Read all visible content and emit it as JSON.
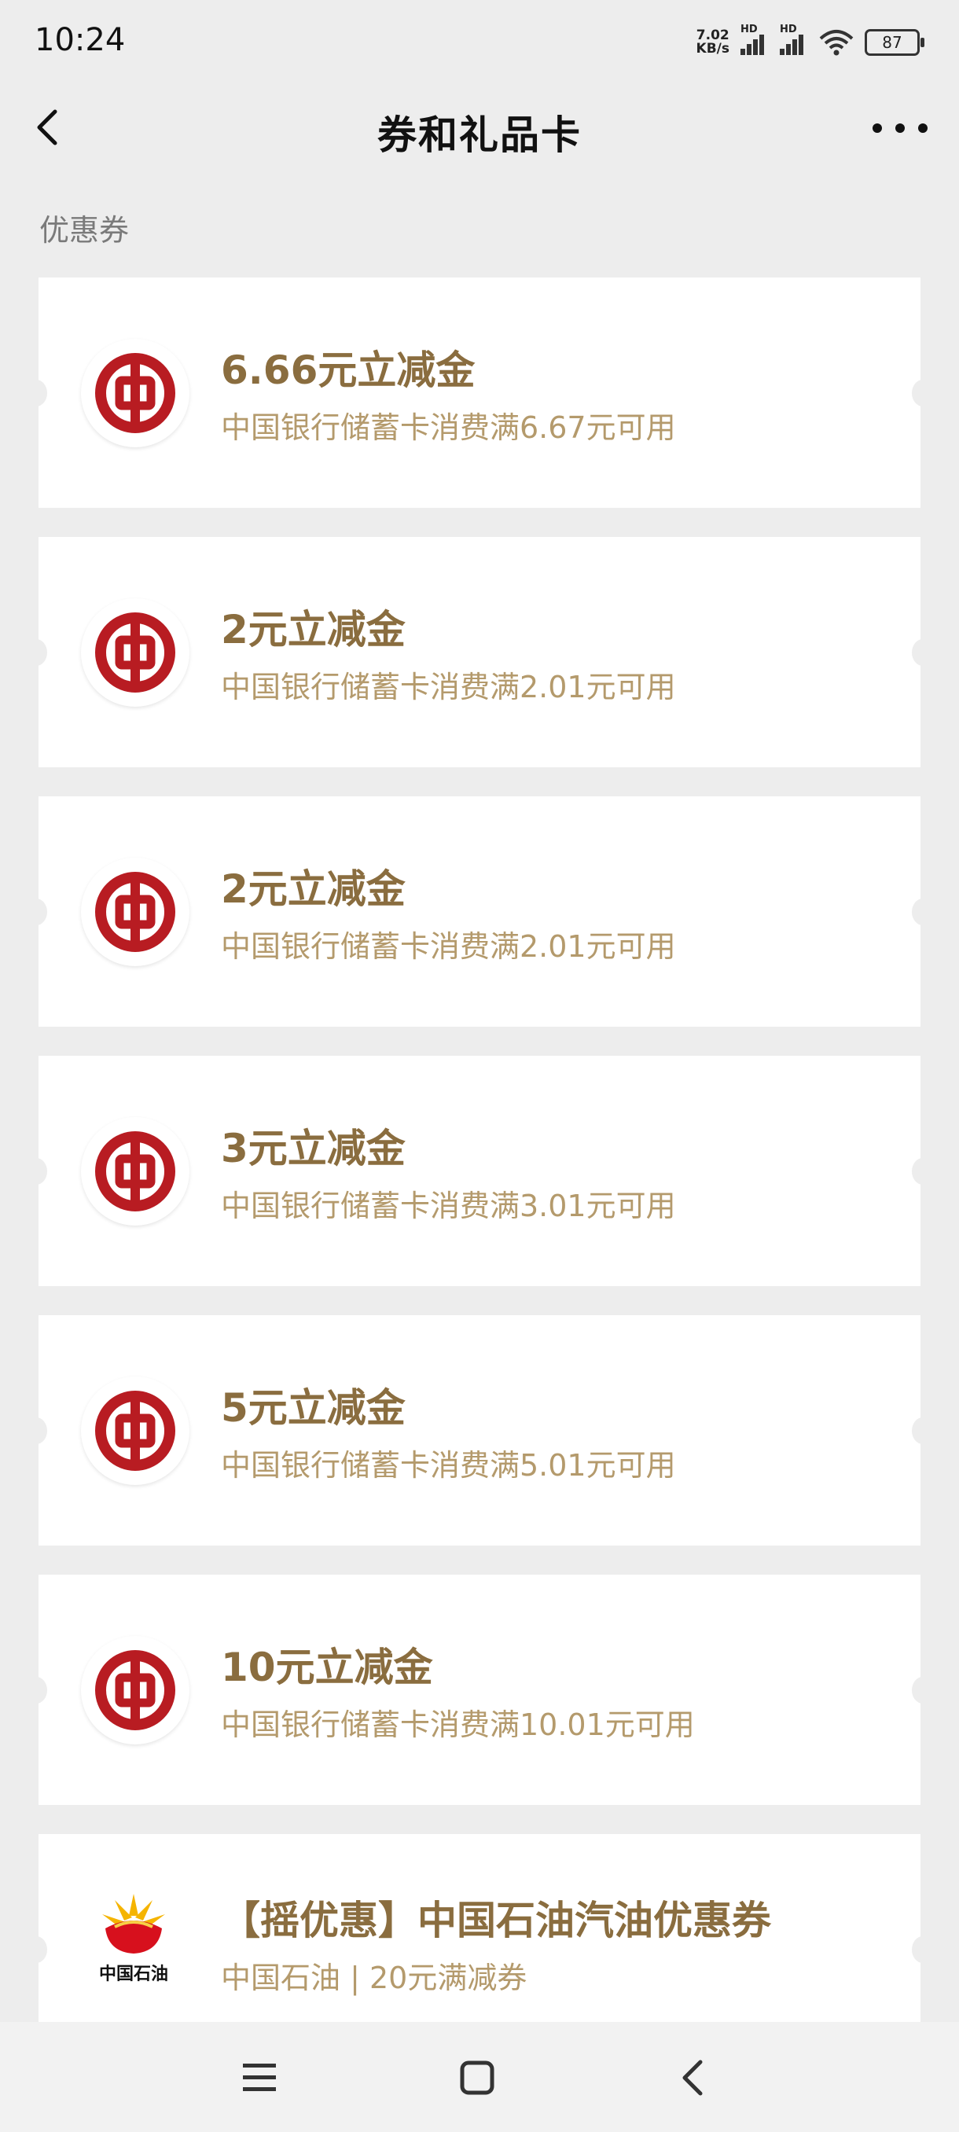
{
  "status_bar": {
    "time": "10:24",
    "net_speed_value": "7.02",
    "net_speed_unit": "KB/s",
    "sim1_label": "HD",
    "sim2_label": "HD",
    "battery": "87"
  },
  "header": {
    "title": "券和礼品卡"
  },
  "section": {
    "label": "优惠券"
  },
  "coupons": [
    {
      "title": "6.66元立减金",
      "desc": "中国银行储蓄卡消费满6.67元可用",
      "logo": "boc-logo-icon"
    },
    {
      "title": "2元立减金",
      "desc": "中国银行储蓄卡消费满2.01元可用",
      "logo": "boc-logo-icon"
    },
    {
      "title": "2元立减金",
      "desc": "中国银行储蓄卡消费满2.01元可用",
      "logo": "boc-logo-icon"
    },
    {
      "title": "3元立减金",
      "desc": "中国银行储蓄卡消费满3.01元可用",
      "logo": "boc-logo-icon"
    },
    {
      "title": "5元立减金",
      "desc": "中国银行储蓄卡消费满5.01元可用",
      "logo": "boc-logo-icon"
    },
    {
      "title": "10元立减金",
      "desc": "中国银行储蓄卡消费满10.01元可用",
      "logo": "boc-logo-icon"
    },
    {
      "title": "【摇优惠】中国石油汽油优惠券",
      "desc": "中国石油 | 20元满减券",
      "logo": "petrochina-logo-icon",
      "logo_text": "中国石油"
    }
  ],
  "colors": {
    "title_gold": "#8a6d3f",
    "desc_gold": "#b49a6c",
    "boc_red": "#b81c22",
    "background": "#ededed"
  },
  "bottom_nav": {
    "icons": [
      "menu-icon",
      "home-square-icon",
      "back-chevron-icon"
    ]
  }
}
